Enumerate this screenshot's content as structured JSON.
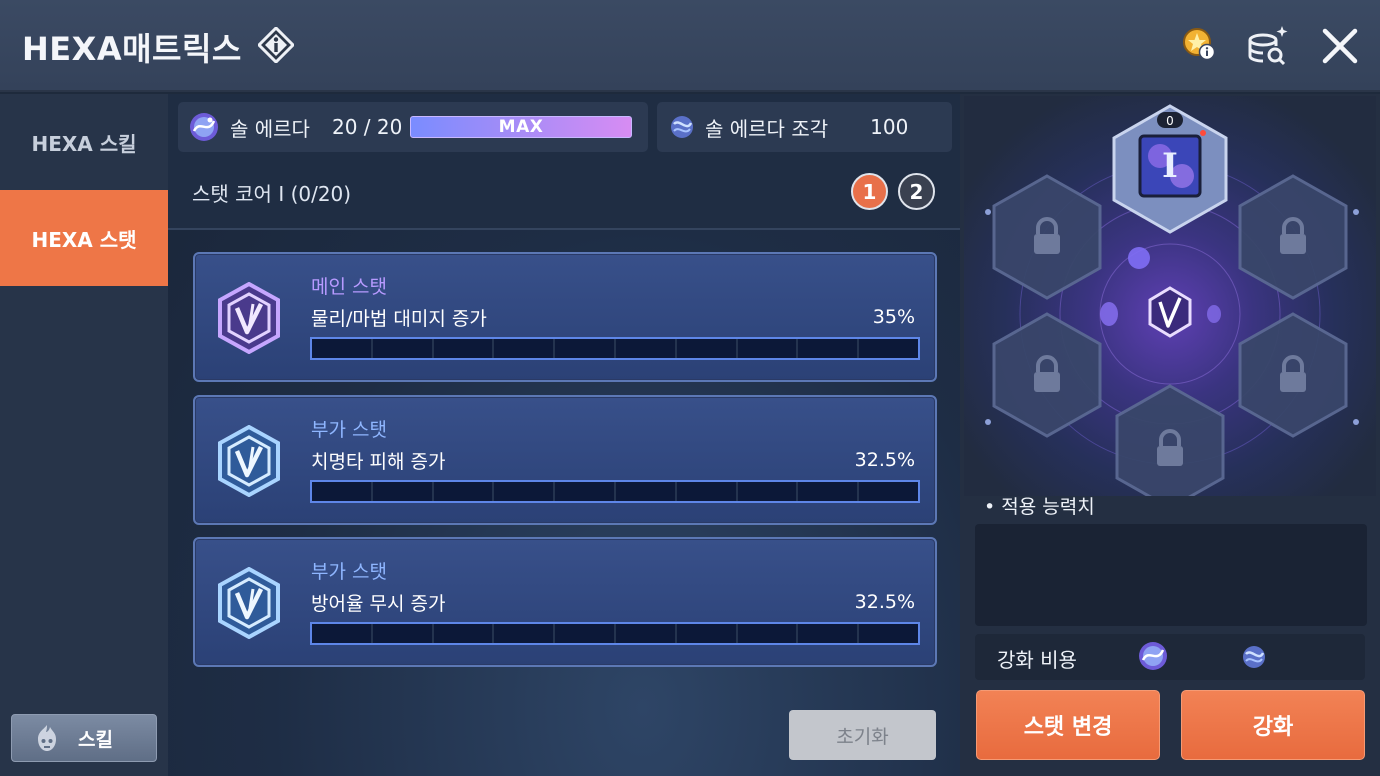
{
  "header": {
    "title": "HEXA매트릭스",
    "info_icon": "info-diamond-icon",
    "icons": [
      "gold-coin-info-icon",
      "coin-stack-search-icon",
      "close-icon"
    ]
  },
  "sidebar": {
    "tabs": [
      {
        "label": "HEXA 스킬",
        "active": false
      },
      {
        "label": "HEXA 스탯",
        "active": true
      }
    ],
    "skill_button_label": "스킬"
  },
  "resources": {
    "sol_erda": {
      "label": "솔 에르다",
      "value": "20 / 20",
      "bar_label": "MAX",
      "fill": 1.0
    },
    "fragment": {
      "label": "솔 에르다 조각",
      "value": "100"
    }
  },
  "core": {
    "title": "스탯 코어 I (0/20)",
    "pages": [
      "1",
      "2"
    ],
    "active_page": 0
  },
  "stats": [
    {
      "kind": "메인 스탯",
      "name": "물리/마법 대미지 증가",
      "pct": "35%",
      "level": 0,
      "max": 10,
      "kind_color": "#b79aff"
    },
    {
      "kind": "부가 스탯",
      "name": "치명타 피해 증가",
      "pct": "32.5%",
      "level": 0,
      "max": 10,
      "kind_color": "#8fb6ff"
    },
    {
      "kind": "부가 스탯",
      "name": "방어율 무시 증가",
      "pct": "32.5%",
      "level": 0,
      "max": 10,
      "kind_color": "#8fb6ff"
    }
  ],
  "reset_button": "초기화",
  "hex_map": {
    "top_slot_level": "0",
    "top_slot_numeral": "I",
    "locked_slots": 5
  },
  "apply_label": "• 적용 능력치",
  "cost_label": "강화 비용",
  "buttons": {
    "change": "스탯 변경",
    "upgrade": "강화"
  },
  "colors": {
    "accent_orange": "#ee7647",
    "bar_blue": "#5e86e8"
  }
}
